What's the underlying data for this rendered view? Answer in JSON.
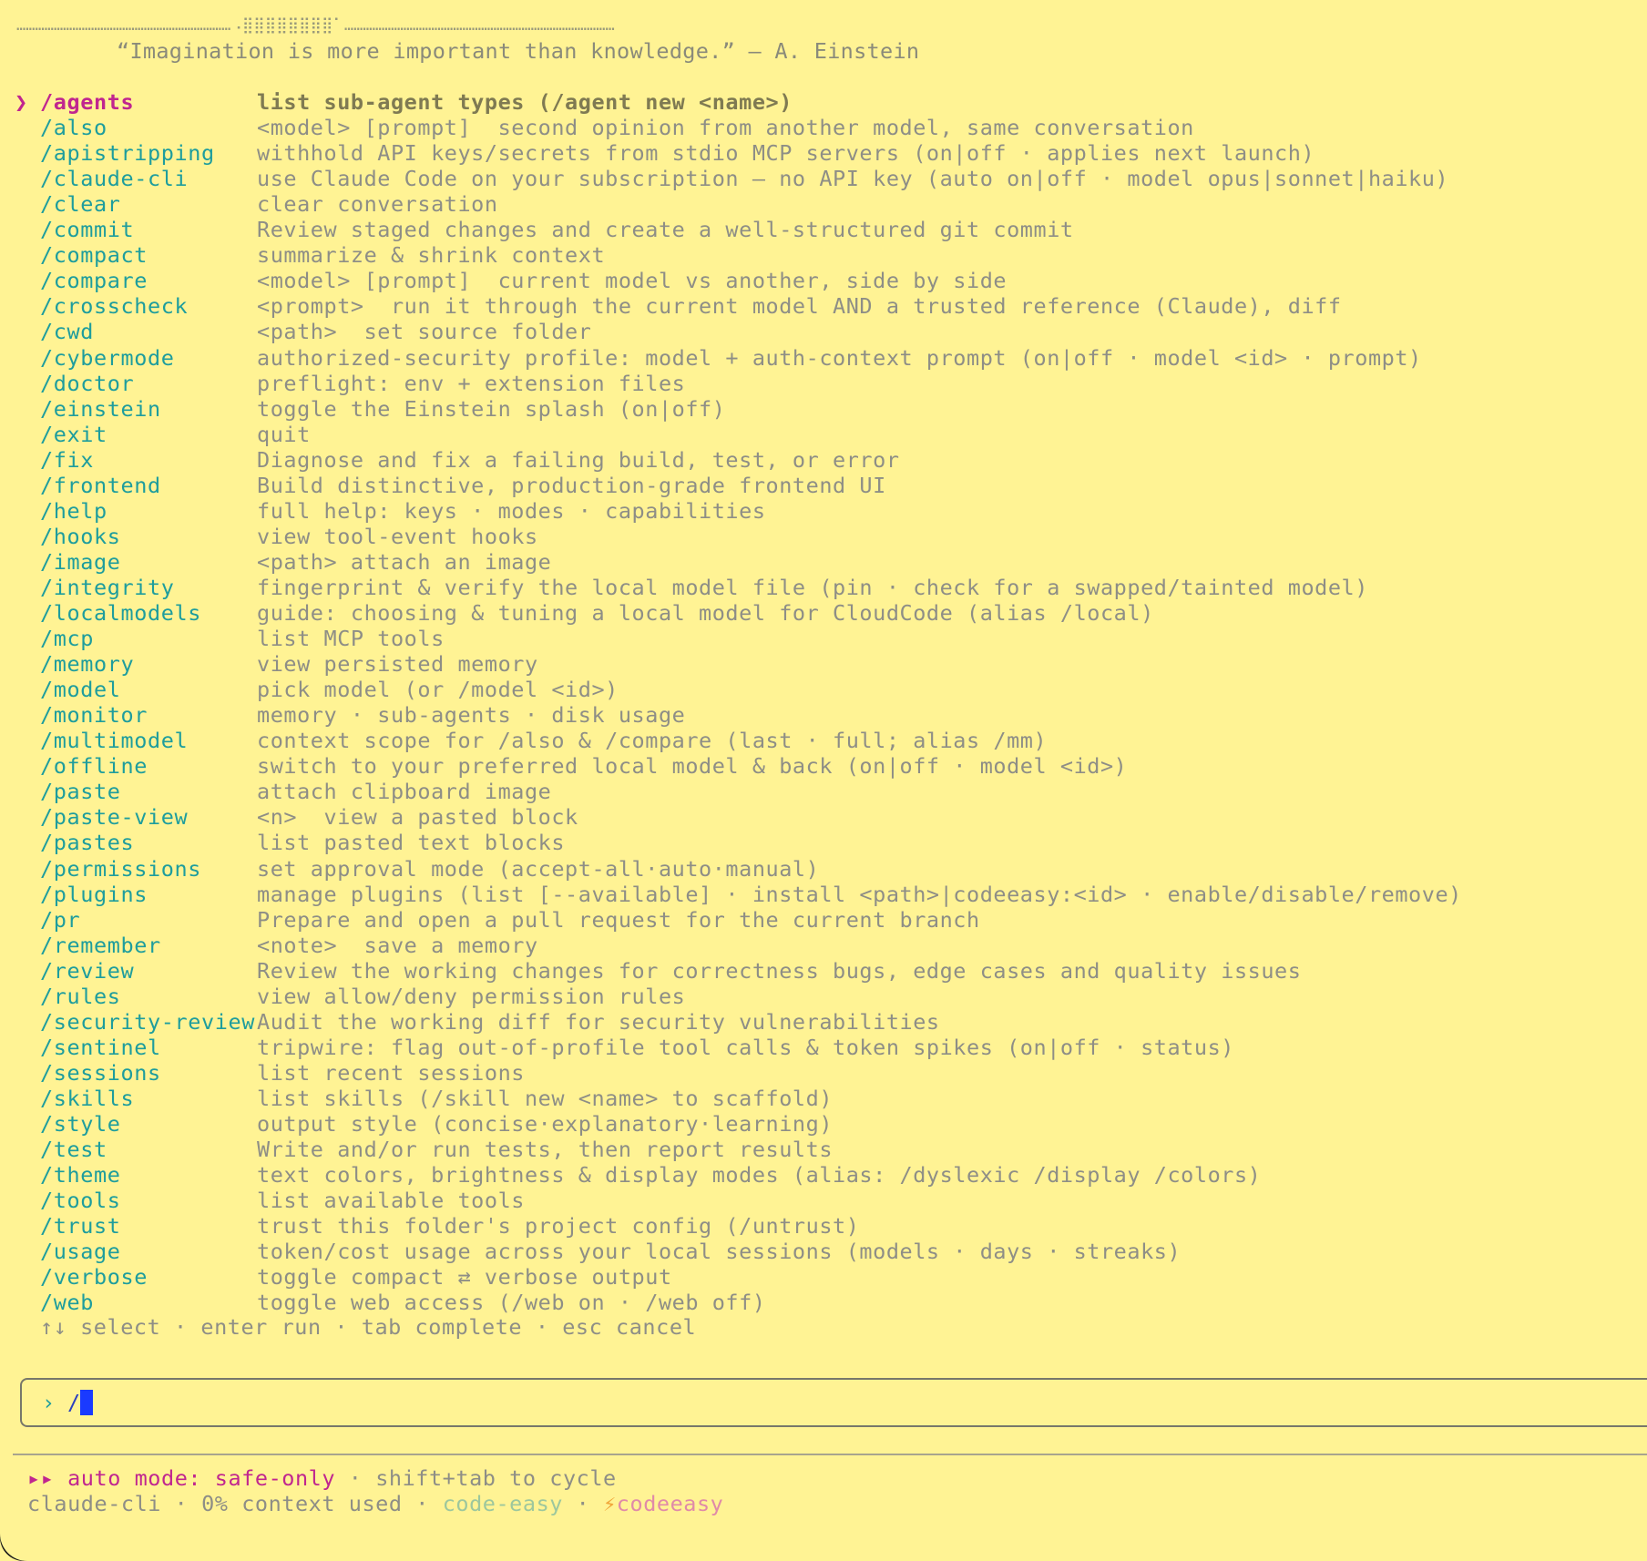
{
  "splash": {
    "dots": "……………………………………………………………⠠⣿⣿⣿⣿⣿⣿⣿⣿⠁……………………………………………………………………………",
    "quote": "“Imagination is more important than knowledge.” — A. Einstein"
  },
  "selector": {
    "caret": "❯",
    "selected_index": 0
  },
  "commands": [
    {
      "name": "/agents",
      "desc": "list sub-agent types (/agent new <name>)"
    },
    {
      "name": "/also",
      "desc": "<model> [prompt]  second opinion from another model, same conversation"
    },
    {
      "name": "/apistripping",
      "desc": "withhold API keys/secrets from stdio MCP servers (on|off · applies next launch)"
    },
    {
      "name": "/claude-cli",
      "desc": "use Claude Code on your subscription — no API key (auto on|off · model opus|sonnet|haiku)"
    },
    {
      "name": "/clear",
      "desc": "clear conversation"
    },
    {
      "name": "/commit",
      "desc": "Review staged changes and create a well-structured git commit"
    },
    {
      "name": "/compact",
      "desc": "summarize & shrink context"
    },
    {
      "name": "/compare",
      "desc": "<model> [prompt]  current model vs another, side by side"
    },
    {
      "name": "/crosscheck",
      "desc": "<prompt>  run it through the current model AND a trusted reference (Claude), diff"
    },
    {
      "name": "/cwd",
      "desc": "<path>  set source folder"
    },
    {
      "name": "/cybermode",
      "desc": "authorized-security profile: model + auth-context prompt (on|off · model <id> · prompt)"
    },
    {
      "name": "/doctor",
      "desc": "preflight: env + extension files"
    },
    {
      "name": "/einstein",
      "desc": "toggle the Einstein splash (on|off)"
    },
    {
      "name": "/exit",
      "desc": "quit"
    },
    {
      "name": "/fix",
      "desc": "Diagnose and fix a failing build, test, or error"
    },
    {
      "name": "/frontend",
      "desc": "Build distinctive, production-grade frontend UI"
    },
    {
      "name": "/help",
      "desc": "full help: keys · modes · capabilities"
    },
    {
      "name": "/hooks",
      "desc": "view tool-event hooks"
    },
    {
      "name": "/image",
      "desc": "<path> attach an image"
    },
    {
      "name": "/integrity",
      "desc": "fingerprint & verify the local model file (pin · check for a swapped/tainted model)"
    },
    {
      "name": "/localmodels",
      "desc": "guide: choosing & tuning a local model for CloudCode (alias /local)"
    },
    {
      "name": "/mcp",
      "desc": "list MCP tools"
    },
    {
      "name": "/memory",
      "desc": "view persisted memory"
    },
    {
      "name": "/model",
      "desc": "pick model (or /model <id>)"
    },
    {
      "name": "/monitor",
      "desc": "memory · sub-agents · disk usage"
    },
    {
      "name": "/multimodel",
      "desc": "context scope for /also & /compare (last · full; alias /mm)"
    },
    {
      "name": "/offline",
      "desc": "switch to your preferred local model & back (on|off · model <id>)"
    },
    {
      "name": "/paste",
      "desc": "attach clipboard image"
    },
    {
      "name": "/paste-view",
      "desc": "<n>  view a pasted block"
    },
    {
      "name": "/pastes",
      "desc": "list pasted text blocks"
    },
    {
      "name": "/permissions",
      "desc": "set approval mode (accept-all·auto·manual)"
    },
    {
      "name": "/plugins",
      "desc": "manage plugins (list [--available] · install <path>|codeeasy:<id> · enable/disable/remove)"
    },
    {
      "name": "/pr",
      "desc": "Prepare and open a pull request for the current branch"
    },
    {
      "name": "/remember",
      "desc": "<note>  save a memory"
    },
    {
      "name": "/review",
      "desc": "Review the working changes for correctness bugs, edge cases and quality issues"
    },
    {
      "name": "/rules",
      "desc": "view allow/deny permission rules"
    },
    {
      "name": "/security-review",
      "desc": "Audit the working diff for security vulnerabilities"
    },
    {
      "name": "/sentinel",
      "desc": "tripwire: flag out-of-profile tool calls & token spikes (on|off · status)"
    },
    {
      "name": "/sessions",
      "desc": "list recent sessions"
    },
    {
      "name": "/skills",
      "desc": "list skills (/skill new <name> to scaffold)"
    },
    {
      "name": "/style",
      "desc": "output style (concise·explanatory·learning)"
    },
    {
      "name": "/test",
      "desc": "Write and/or run tests, then report results"
    },
    {
      "name": "/theme",
      "desc": "text colors, brightness & display modes (alias: /dyslexic /display /colors)"
    },
    {
      "name": "/tools",
      "desc": "list available tools"
    },
    {
      "name": "/trust",
      "desc": "trust this folder's project config (/untrust)"
    },
    {
      "name": "/usage",
      "desc": "token/cost usage across your local sessions (models · days · streaks)"
    },
    {
      "name": "/verbose",
      "desc": "toggle compact ⇄ verbose output"
    },
    {
      "name": "/web",
      "desc": "toggle web access (/web on · /web off)"
    }
  ],
  "hint": "↑↓ select · enter run · tab complete · esc cancel",
  "input": {
    "prompt_symbol": "›",
    "value": "/"
  },
  "status": {
    "mode_arrows": "▸▸",
    "mode_label": "auto mode: safe-only",
    "mode_sep": " · ",
    "mode_hint": "shift+tab to cycle",
    "model": "claude-cli",
    "sep1": " · ",
    "context": "0% context used",
    "sep2": " · ",
    "brand_a": "code-easy",
    "sep3": " · ",
    "bolt": "⚡",
    "brand_b": "codeeasy"
  },
  "colors": {
    "background": "#fff394",
    "command": "#1e9d9d",
    "selected": "#c0268f",
    "muted": "#8e8e86",
    "cursor": "#1a3aff"
  }
}
